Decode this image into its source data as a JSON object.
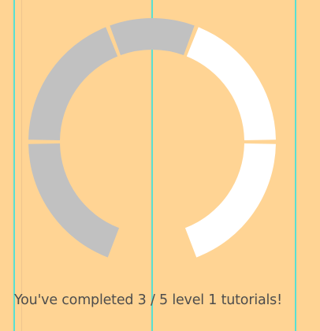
{
  "progress": {
    "completed": 3,
    "total": 5,
    "segments": [
      {
        "state": "completed"
      },
      {
        "state": "completed"
      },
      {
        "state": "completed"
      },
      {
        "state": "incomplete"
      },
      {
        "state": "incomplete"
      }
    ]
  },
  "status_text": "You've completed 3 / 5 level 1 tutorials!",
  "colors": {
    "background": "#ffd494",
    "completed": "#c1c1c1",
    "incomplete": "#ffffff",
    "guide": "#58e0d2"
  }
}
